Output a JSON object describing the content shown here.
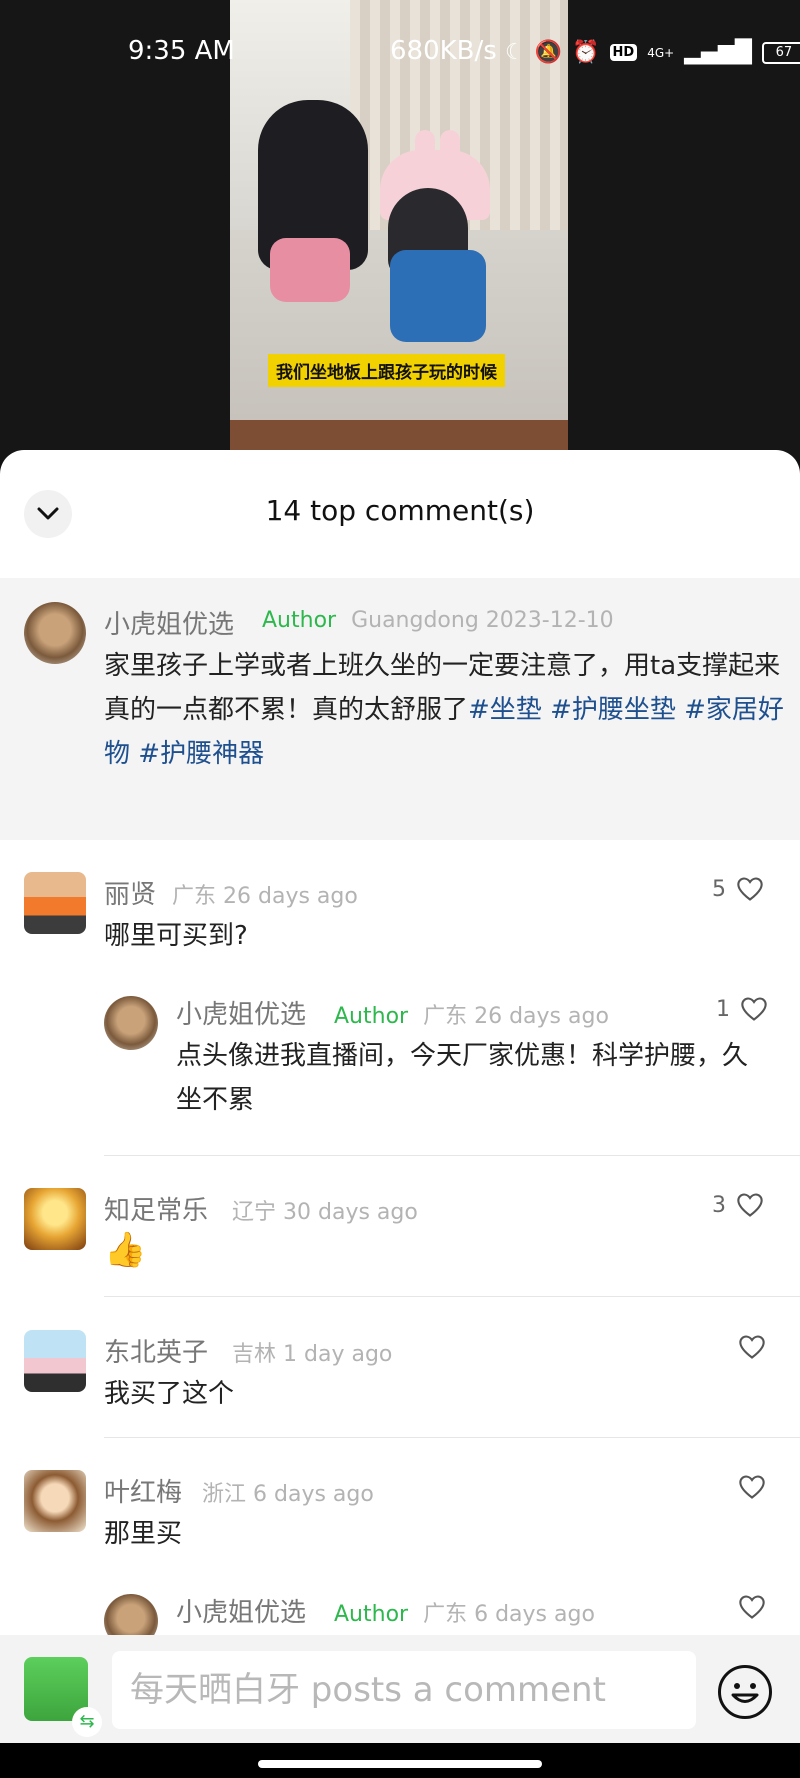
{
  "status_bar": {
    "time": "9:35 AM",
    "network_speed": "680KB/s",
    "network_type": "4G+",
    "hd_label": "HD",
    "battery": "67",
    "icons": [
      "moon-icon",
      "mute-icon",
      "alarm-icon",
      "hd-icon",
      "signal-icon",
      "battery-icon"
    ]
  },
  "video": {
    "subtitle": "我们坐地板上跟孩子玩的时候"
  },
  "sheet": {
    "title": "14 top comment(s)",
    "collapse_icon": "chevron-down-icon"
  },
  "pinned": {
    "name": "小虎姐优选",
    "author_label": "Author",
    "location": "Guangdong",
    "date": "2023-12-10",
    "text_plain": "家里孩子上学或者上班久坐的一定要注意了，用ta支撑起来真的一点都不累！真的太舒服了",
    "tags": [
      "#坐垫",
      "#护腰坐垫",
      "#家居好物",
      "#护腰神器"
    ]
  },
  "comments": [
    {
      "name": "丽贤",
      "location": "广东",
      "time": "26 days ago",
      "likes": "5",
      "text": "哪里可买到?",
      "reply": {
        "name": "小虎姐优选",
        "author_label": "Author",
        "location": "广东",
        "time": "26 days ago",
        "likes": "1",
        "text": "点头像进我直播间，今天厂家优惠！科学护腰，久坐不累"
      }
    },
    {
      "name": "知足常乐",
      "location": "辽宁",
      "time": "30 days ago",
      "likes": "3",
      "text": "👍"
    },
    {
      "name": "东北英子",
      "location": "吉林",
      "time": "1 day ago",
      "likes": "",
      "text": "我买了这个"
    },
    {
      "name": "叶红梅",
      "location": "浙江",
      "time": "6 days ago",
      "likes": "",
      "text": "那里买",
      "reply": {
        "name": "小虎姐优选",
        "author_label": "Author",
        "location": "广东",
        "time": "6 days ago",
        "likes": ""
      }
    }
  ],
  "composer": {
    "placeholder": "每天晒白牙 posts a comment",
    "emoji_icon": "smiley-icon",
    "swap_icon": "swap-icon"
  }
}
